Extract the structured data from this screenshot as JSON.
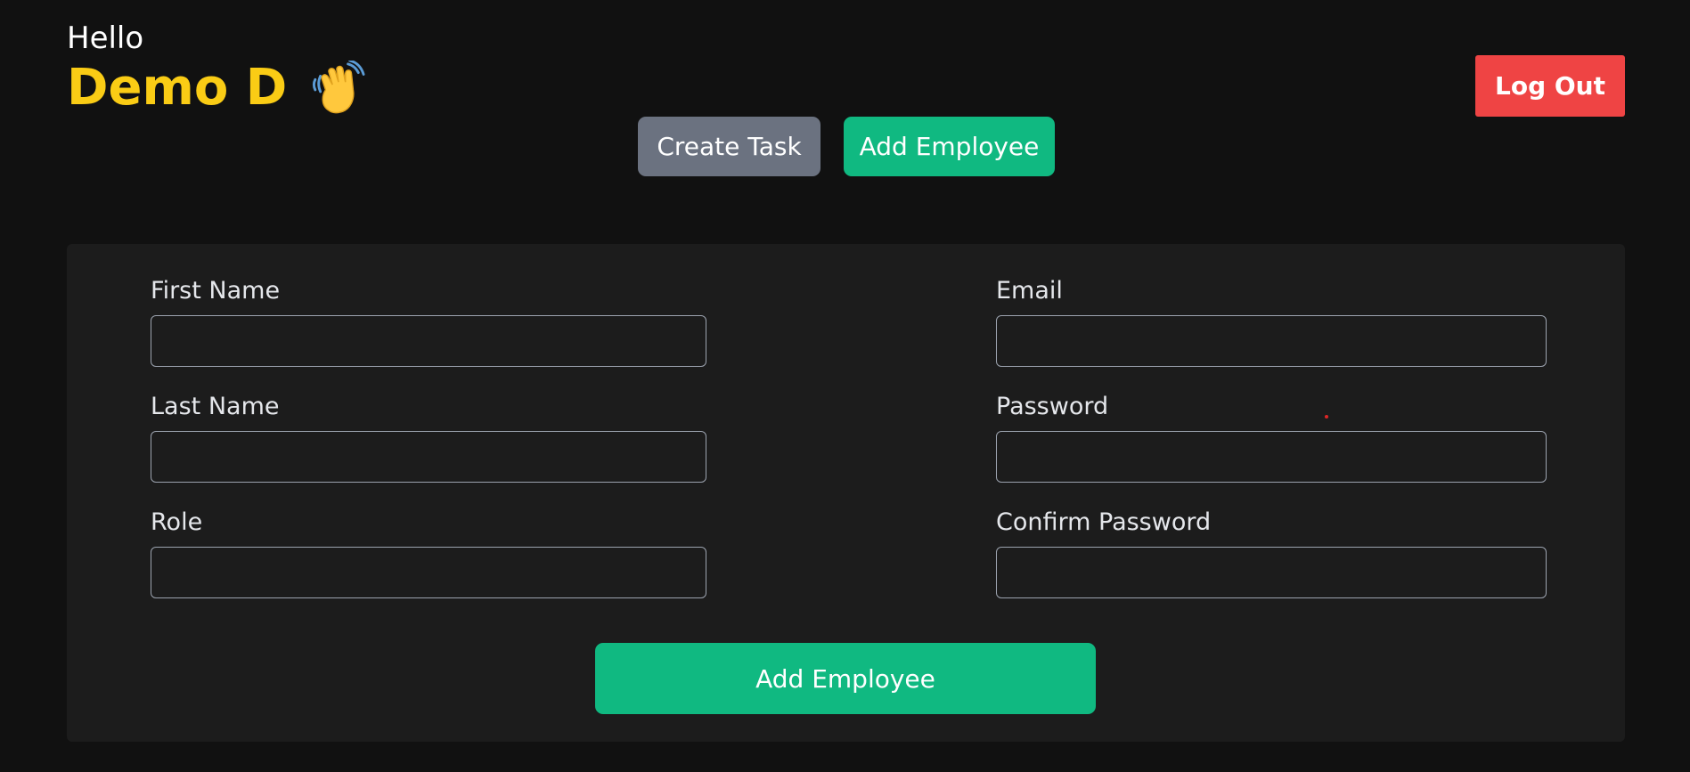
{
  "header": {
    "greeting": "Hello",
    "user_name": "Demo D",
    "wave_icon": "waving-hand-icon",
    "logout_label": "Log Out"
  },
  "tabs": {
    "create_task_label": "Create Task",
    "add_employee_label": "Add Employee"
  },
  "form": {
    "first_name": {
      "label": "First Name",
      "value": ""
    },
    "last_name": {
      "label": "Last Name",
      "value": ""
    },
    "role": {
      "label": "Role",
      "value": ""
    },
    "email": {
      "label": "Email",
      "value": ""
    },
    "password": {
      "label": "Password",
      "value": ""
    },
    "confirm_password": {
      "label": "Confirm Password",
      "value": ""
    },
    "submit_label": "Add Employee"
  },
  "colors": {
    "background": "#111111",
    "panel": "#1C1C1C",
    "accent_yellow": "#FACC15",
    "green": "#10B981",
    "gray": "#6B7280",
    "red": "#EF4444"
  }
}
